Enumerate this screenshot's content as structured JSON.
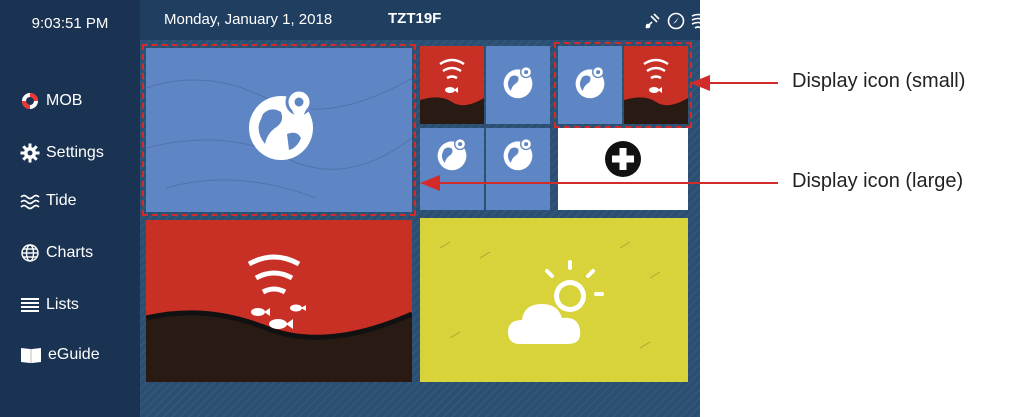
{
  "status": {
    "time": "9:03:51 PM",
    "date": "Monday, January 1, 2018",
    "model": "TZT19F"
  },
  "sidebar": {
    "items": [
      {
        "label": "MOB",
        "icon": "lifebuoy-icon"
      },
      {
        "label": "Settings",
        "icon": "gear-icon"
      },
      {
        "label": "Tide",
        "icon": "waves-icon"
      },
      {
        "label": "Charts",
        "icon": "globe-icon"
      },
      {
        "label": "Lists",
        "icon": "list-icon"
      },
      {
        "label": "eGuide",
        "icon": "book-icon"
      }
    ]
  },
  "status_icons": [
    "satellite-icon",
    "compass-icon",
    "signal-icon"
  ],
  "tiles": {
    "large_chart": {
      "icon": "globe-pin-icon"
    },
    "small_sonar_1": {
      "icon": "sonar-fish-icon"
    },
    "small_chart_1": {
      "icon": "globe-pin-icon"
    },
    "small_chart_2": {
      "icon": "globe-pin-icon"
    },
    "small_sonar_2": {
      "icon": "sonar-fish-icon"
    },
    "small_chart_3": {
      "icon": "globe-pin-icon"
    },
    "small_chart_4": {
      "icon": "globe-pin-icon"
    },
    "add_display": {
      "icon": "plus-circle-icon"
    },
    "large_sonar": {
      "icon": "sonar-fish-icon"
    },
    "weather": {
      "icon": "weather-cloud-sun-icon"
    }
  },
  "callouts": {
    "small": "Display icon (small)",
    "large": "Display icon (large)"
  },
  "colors": {
    "chart_tile": "#5f86c4",
    "sonar_tile": "#c83026",
    "weather_tile": "#d8d33a",
    "sidebar": "#1b3352",
    "annotation": "#d32a2a"
  }
}
